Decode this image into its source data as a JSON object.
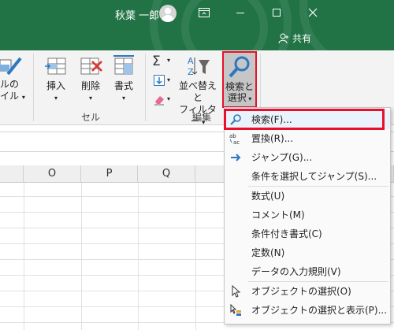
{
  "titlebar": {
    "user_name": "秋葉 一郎",
    "share_label": "共有",
    "color": "#217346",
    "icons": [
      "avatar-icon",
      "ribbon-display-icon",
      "minimize-icon",
      "maximize-icon",
      "close-icon",
      "person-icon"
    ]
  },
  "ribbon": {
    "style_cutoff_top": "ルの",
    "style_cutoff_bottom": "イル",
    "insert_label": "挿入",
    "delete_label": "削除",
    "format_label": "書式",
    "cells_group_label": "セル",
    "sort_filter_label_1": "並べ替えと",
    "sort_filter_label_2": "フィルター",
    "find_select_label_1": "検索と",
    "find_select_label_2": "選択",
    "editing_group_label": "編集",
    "highlight_color": "#e8102a"
  },
  "grid": {
    "columns": [
      "O",
      "P",
      "Q"
    ]
  },
  "menu": {
    "items": [
      {
        "label": "検索(F)...",
        "icon": "search-icon"
      },
      {
        "label": "置換(R)...",
        "icon": "replace-icon"
      },
      {
        "label": "ジャンプ(G)...",
        "icon": "arrow-right-icon"
      },
      {
        "label": "条件を選択してジャンプ(S)...",
        "icon": ""
      },
      {
        "label": "数式(U)",
        "icon": ""
      },
      {
        "label": "コメント(M)",
        "icon": ""
      },
      {
        "label": "条件付き書式(C)",
        "icon": ""
      },
      {
        "label": "定数(N)",
        "icon": ""
      },
      {
        "label": "データの入力規則(V)",
        "icon": ""
      },
      {
        "label": "オブジェクトの選択(O)",
        "icon": "pointer-icon"
      },
      {
        "label": "オブジェクトの選択と表示(P)...",
        "icon": "selection-pane-icon"
      }
    ]
  }
}
